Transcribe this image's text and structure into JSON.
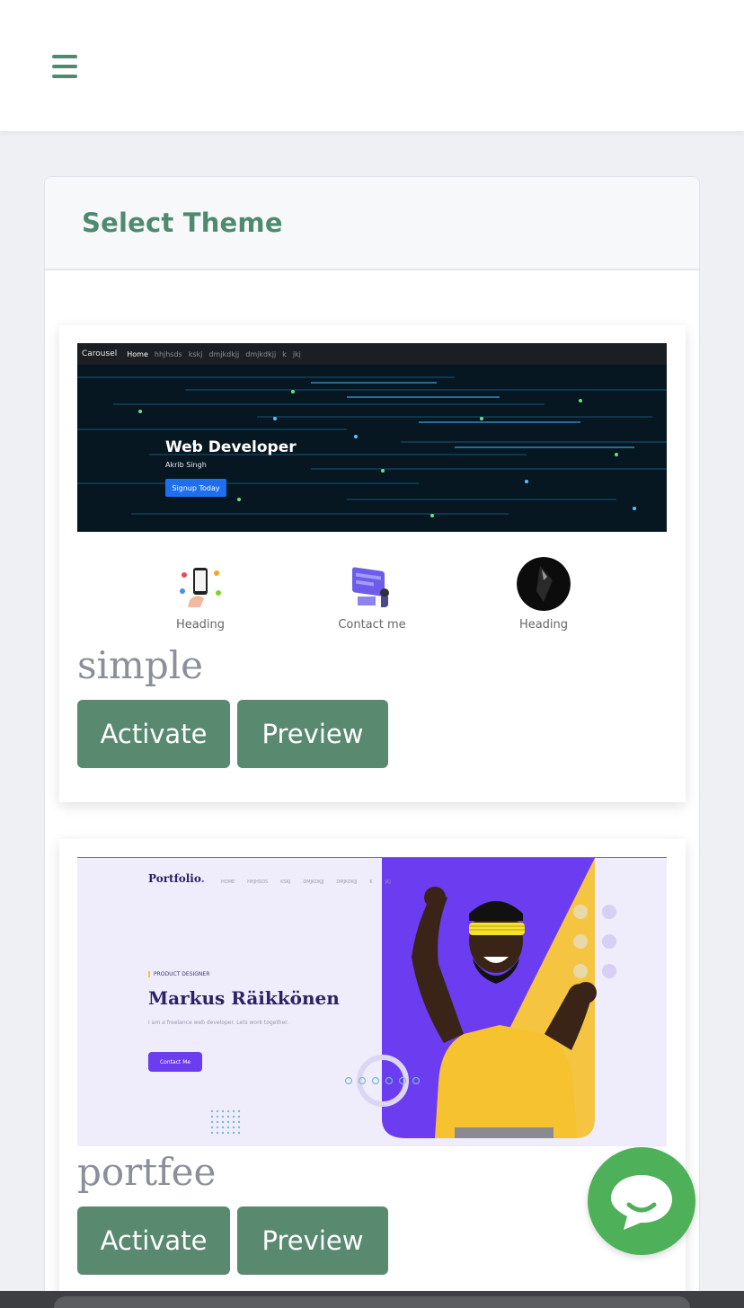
{
  "header": {
    "menu_icon": "hamburger-menu-icon"
  },
  "panel": {
    "title": "Select Theme"
  },
  "themes": [
    {
      "name": "simple",
      "activate_label": "Activate",
      "preview_label": "Preview",
      "thumbnail": {
        "nav_brand": "Carousel",
        "nav_items": [
          "Home",
          "hhjhsds",
          "kskj",
          "dmjkdkjj",
          "dmjkdkjj",
          "k",
          "jkj"
        ],
        "hero_title": "Web Developer",
        "hero_subtitle": "Akrib Singh",
        "hero_button": "Signup Today",
        "features": [
          "Heading",
          "Contact me",
          "Heading"
        ]
      }
    },
    {
      "name": "portfee",
      "activate_label": "Activate",
      "preview_label": "Preview",
      "thumbnail": {
        "logo": "Portfolio",
        "logo_dot": ".",
        "nav_items": [
          "HOME",
          "HHJHSDS",
          "KSKJ",
          "DMJKDKJJ",
          "DMJKDKJJ",
          "K",
          "JKJ"
        ],
        "tagline": "PRODUCT DESIGNER",
        "person_name": "Markus Räikkönen",
        "description": "I am a freelance web developer. Lets work together.",
        "button": "Contact Me"
      }
    }
  ],
  "chat_button": {
    "icon": "chat-bubble-icon"
  },
  "colors": {
    "accent": "#598a70",
    "title": "#4f8a70",
    "chat": "#4fb05a"
  }
}
